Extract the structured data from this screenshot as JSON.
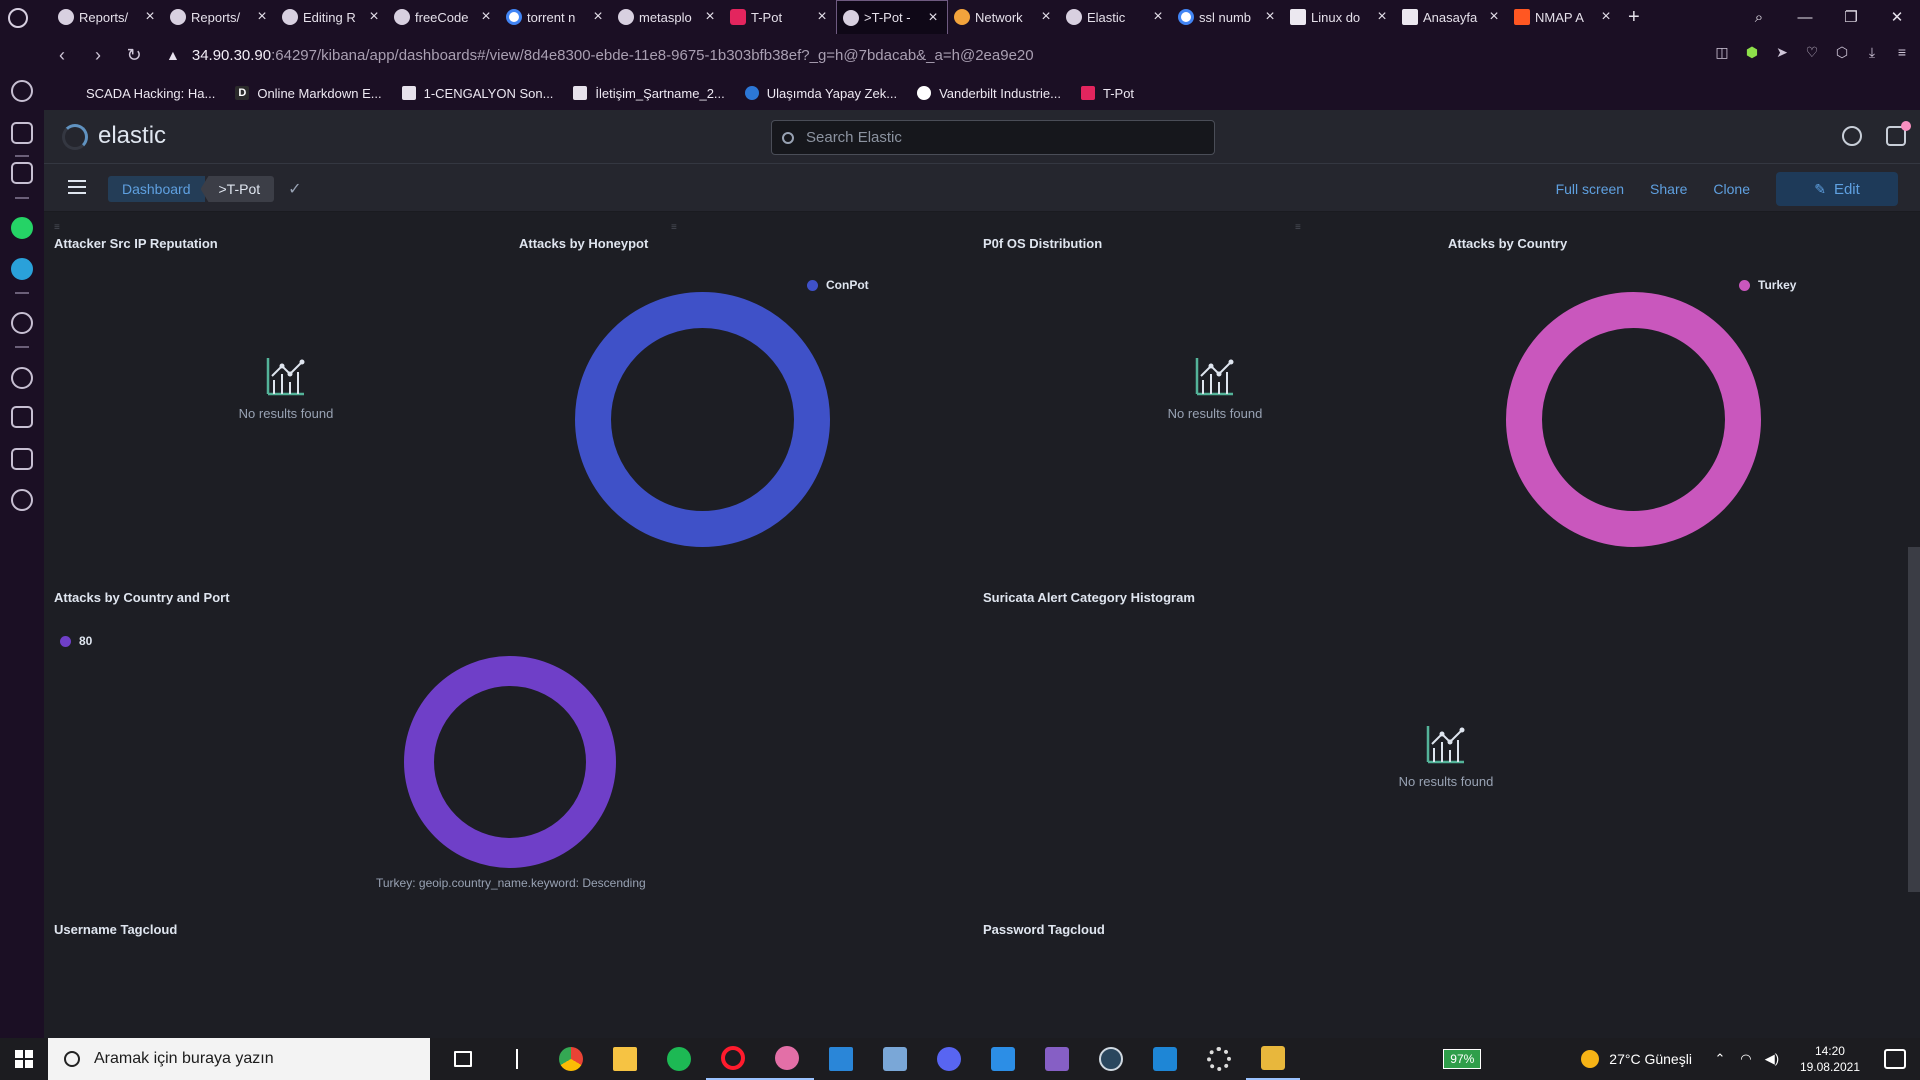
{
  "browser": {
    "tabs": [
      {
        "label": "Reports/",
        "icon": "github"
      },
      {
        "label": "Reports/",
        "icon": "github"
      },
      {
        "label": "Editing R",
        "icon": "github"
      },
      {
        "label": "freeCode",
        "icon": "github"
      },
      {
        "label": "torrent n",
        "icon": "google"
      },
      {
        "label": "metasplo",
        "icon": "github"
      },
      {
        "label": "T-Pot",
        "icon": "tpot"
      },
      {
        "label": ">T-Pot -",
        "icon": "kibana",
        "active": true
      },
      {
        "label": "Network",
        "icon": "network"
      },
      {
        "label": "Elastic",
        "icon": "kibana"
      },
      {
        "label": "ssl numb",
        "icon": "google"
      },
      {
        "label": "Linux do",
        "icon": "doc"
      },
      {
        "label": "Anasayfa",
        "icon": "doc"
      },
      {
        "label": "NMAP A",
        "icon": "nmap"
      }
    ],
    "url_host": "34.90.30.90",
    "url_rest": ":64297/kibana/app/dashboards#/view/8d4e8300-ebde-11e8-9675-1b303bfb38ef?_g=h@7bdacab&_a=h@2ea9e20",
    "bookmarks": [
      {
        "label": "SCADA Hacking: Ha...",
        "icon": "none"
      },
      {
        "label": "Online Markdown E...",
        "icon": "d"
      },
      {
        "label": "1-CENGALYON Son...",
        "icon": "doc"
      },
      {
        "label": "İletişim_Şartname_2...",
        "icon": "doc"
      },
      {
        "label": "Ulaşımda Yapay Zek...",
        "icon": "blue"
      },
      {
        "label": "Vanderbilt Industrie...",
        "icon": "vb"
      },
      {
        "label": "T-Pot",
        "icon": "pink"
      }
    ]
  },
  "kibana": {
    "logo_text": "elastic",
    "search_placeholder": "Search Elastic",
    "breadcrumbs": [
      "Dashboard",
      ">T-Pot"
    ],
    "actions": {
      "full_screen": "Full screen",
      "share": "Share",
      "clone": "Clone",
      "edit": "Edit"
    },
    "panels": {
      "attacker_src_ip": {
        "title": "Attacker Src IP Reputation",
        "empty_message": "No results found"
      },
      "attacks_by_honeypot": {
        "title": "Attacks by Honeypot",
        "legend": "ConPot",
        "color": "#3f51c8"
      },
      "p0f_os": {
        "title": "P0f OS Distribution",
        "empty_message": "No results found"
      },
      "attacks_by_country": {
        "title": "Attacks by Country",
        "legend": "Turkey",
        "color": "#c957bd"
      },
      "attacks_by_country_port": {
        "title": "Attacks by Country and Port",
        "legend": "80",
        "color": "#6f3fc8",
        "axis_label": "Turkey: geoip.country_name.keyword: Descending"
      },
      "suricata": {
        "title": "Suricata Alert Category Histogram",
        "empty_message": "No results found"
      },
      "username_tagcloud": {
        "title": "Username Tagcloud"
      },
      "password_tagcloud": {
        "title": "Password Tagcloud"
      }
    }
  },
  "taskbar": {
    "search_placeholder": "Aramak için buraya yazın",
    "battery": "97%",
    "weather": "27°C  Güneşli",
    "time": "14:20",
    "date": "19.08.2021"
  }
}
